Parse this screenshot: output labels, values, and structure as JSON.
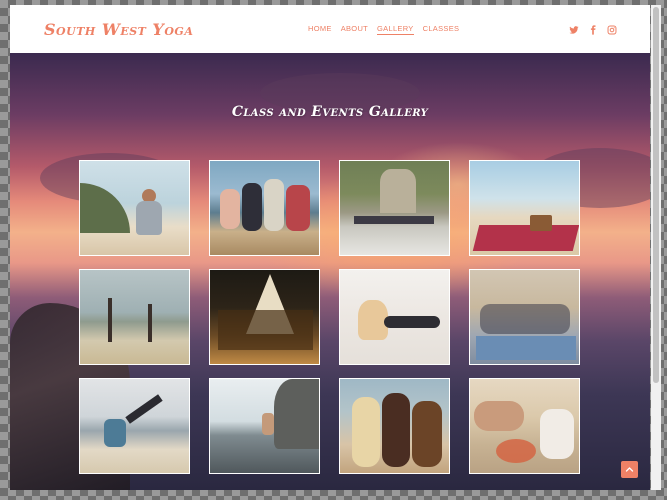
{
  "site": {
    "brand": "South West Yoga"
  },
  "nav": {
    "items": [
      {
        "label": "HOME"
      },
      {
        "label": "ABOUT"
      },
      {
        "label": "GALLERY"
      },
      {
        "label": "CLASSES"
      }
    ],
    "active": "GALLERY"
  },
  "social": {
    "icons": [
      "twitter-icon",
      "facebook-icon",
      "instagram-icon"
    ]
  },
  "gallery": {
    "title": "Class and Events Gallery"
  },
  "colors": {
    "accent": "#ee8166",
    "white": "#ffffff"
  },
  "scroll": {
    "back_to_top_icon": "chevron-up-icon"
  }
}
